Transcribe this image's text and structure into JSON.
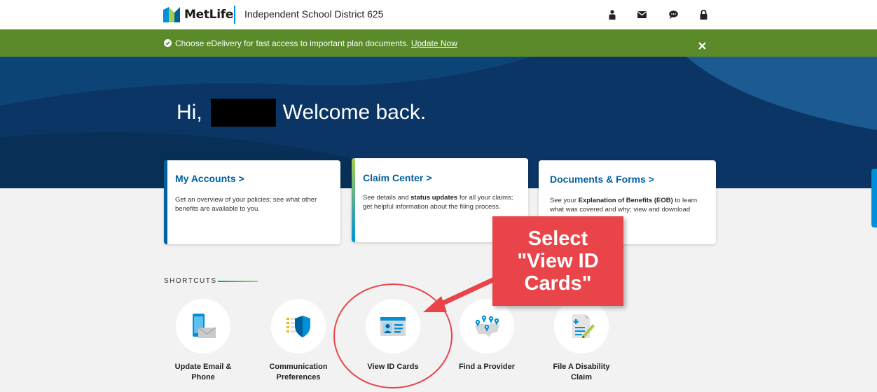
{
  "header": {
    "brand_name": "MetLife",
    "org_name": "Independent School District 625",
    "icons": [
      "person-icon",
      "mail-icon",
      "chat-icon",
      "lock-icon"
    ]
  },
  "banner": {
    "text": "Choose eDelivery for fast access to important plan documents.",
    "link_label": "Update Now",
    "close_label": "✕"
  },
  "hero": {
    "greeting_prefix": "Hi,",
    "greeting_suffix": "Welcome back."
  },
  "cards": [
    {
      "title": "My Accounts  >",
      "desc_lines": [
        "Get an overview of your policies; see what other",
        "benefits are available to you."
      ],
      "accent": "#0061a0"
    },
    {
      "title": "Claim Center  >",
      "desc_line1_a": "See details and ",
      "desc_line1_bold": "status updates",
      "desc_line1_b": " for all your claims;",
      "desc_line2": "get helpful information about the filing process.",
      "accent": "#a4ce4e"
    },
    {
      "title": "Documents & Forms  >",
      "desc_line1_a": "See your ",
      "desc_line1_bold": "Explanation of Benefits (EOB)",
      "desc_line1_b": " to learn",
      "desc_line2": "what was covered and why; view and download",
      "accent": "#ffffff"
    }
  ],
  "shortcuts": {
    "label": "SHORTCUTS",
    "items": [
      {
        "line1": "Update Email &",
        "line2": "Phone",
        "icon": "phone-mail-icon"
      },
      {
        "line1": "Communication",
        "line2": "Preferences",
        "icon": "shield-doc-icon"
      },
      {
        "line1": "View ID Cards",
        "line2": "",
        "icon": "id-card-icon"
      },
      {
        "line1": "Find a Provider",
        "line2": "",
        "icon": "map-pins-icon"
      },
      {
        "line1": "File A Disability",
        "line2": "Claim",
        "icon": "doc-pen-icon"
      }
    ]
  },
  "annotation": {
    "lines": [
      "Select",
      "\"View ID",
      "Cards\""
    ],
    "color": "#e8444a"
  },
  "colors": {
    "brand_blue": "#0090da",
    "brand_green": "#a4ce4e",
    "hero_navy": "#0a3565",
    "banner_green": "#5a8a2a"
  }
}
